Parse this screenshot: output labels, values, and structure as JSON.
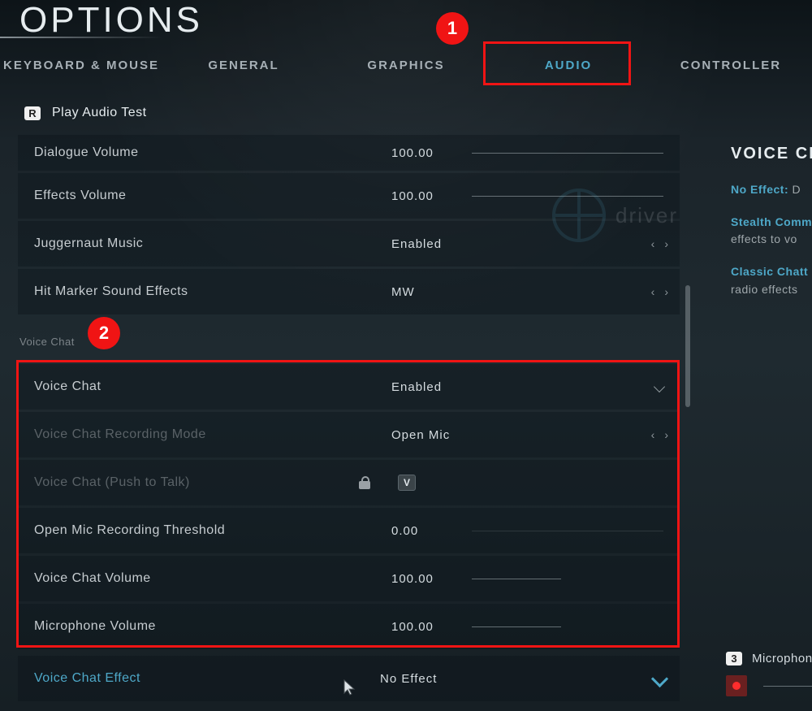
{
  "title": "OPTIONS",
  "tabs": [
    "KEYBOARD & MOUSE",
    "GENERAL",
    "GRAPHICS",
    "AUDIO",
    "CONTROLLER"
  ],
  "activeTab": "AUDIO",
  "playTest": {
    "key": "R",
    "label": "Play Audio Test"
  },
  "markers": {
    "m1": "1",
    "m2": "2",
    "m3": "3"
  },
  "rows": {
    "dialogueVolume": {
      "label": "Dialogue Volume",
      "value": "100.00"
    },
    "effectsVolume": {
      "label": "Effects Volume",
      "value": "100.00"
    },
    "juggernautMusic": {
      "label": "Juggernaut Music",
      "value": "Enabled"
    },
    "hitMarker": {
      "label": "Hit Marker Sound Effects",
      "value": "MW"
    },
    "sectionVoice": "Voice Chat",
    "voiceChat": {
      "label": "Voice Chat",
      "value": "Enabled"
    },
    "recMode": {
      "label": "Voice Chat Recording Mode",
      "value": "Open Mic"
    },
    "ptt": {
      "label": "Voice Chat (Push to Talk)",
      "key": "V"
    },
    "threshold": {
      "label": "Open Mic Recording Threshold",
      "value": "0.00"
    },
    "vcVolume": {
      "label": "Voice Chat Volume",
      "value": "100.00"
    },
    "micVolume": {
      "label": "Microphone Volume",
      "value": "100.00"
    },
    "vcEffect": {
      "label": "Voice Chat Effect",
      "value": "No Effect"
    }
  },
  "help": {
    "title": "VOICE CH",
    "noEffectTerm": "No Effect:",
    "noEffectText": " D",
    "stealthTerm": "Stealth Comm",
    "stealthText": "effects to vo",
    "classicTerm": "Classic Chatt",
    "classicText": "radio effects"
  },
  "micArea": {
    "label": "Microphone"
  }
}
